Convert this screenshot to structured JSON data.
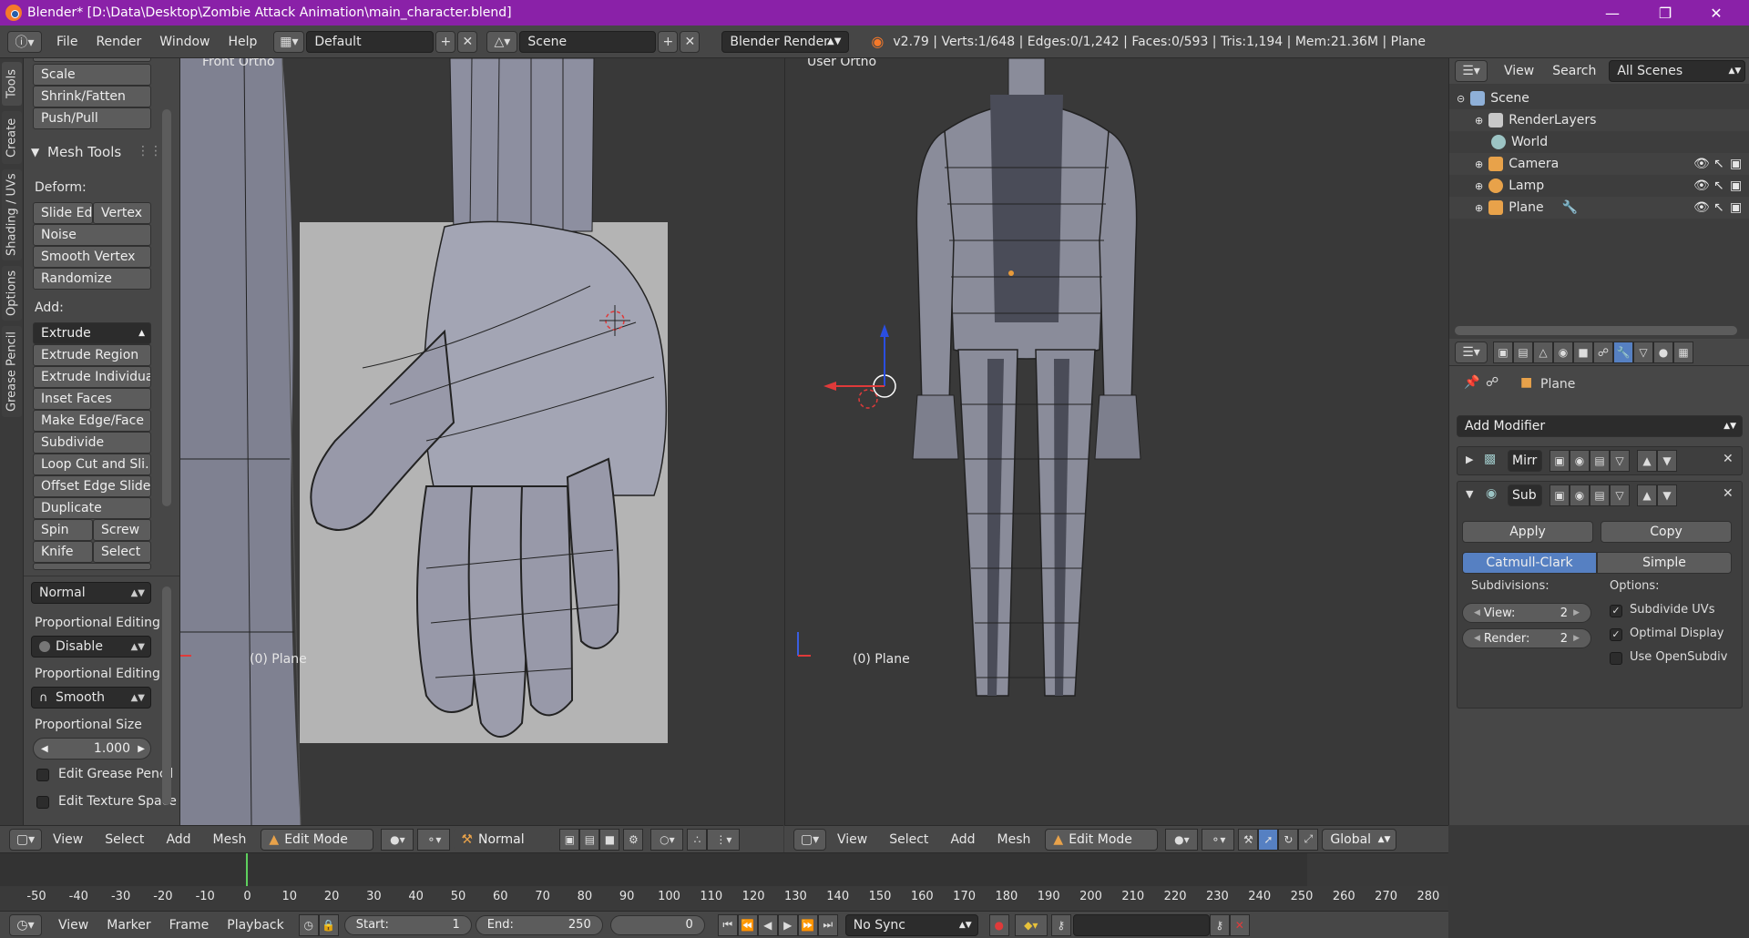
{
  "window": {
    "title": "Blender* [D:\\Data\\Desktop\\Zombie Attack Animation\\main_character.blend]"
  },
  "info_header": {
    "menus": [
      "File",
      "Render",
      "Window",
      "Help"
    ],
    "layout": "Default",
    "scene": "Scene",
    "engine": "Blender Render",
    "stats": "v2.79 | Verts:1/648 | Edges:0/1,242 | Faces:0/593 | Tris:1,194 | Mem:21.36M | Plane"
  },
  "tool_tabs": [
    "Tools",
    "Create",
    "Shading / UVs",
    "Options",
    "Grease Pencil"
  ],
  "tool_shelf": {
    "top_buttons": [
      "Scale",
      "Shrink/Fatten",
      "Push/Pull"
    ],
    "mesh_tools_title": "Mesh Tools",
    "deform_label": "Deform:",
    "deform_row": [
      "Slide Ed",
      "Vertex"
    ],
    "deform_buttons": [
      "Noise",
      "Smooth Vertex",
      "Randomize"
    ],
    "add_label": "Add:",
    "extrude": "Extrude",
    "add_buttons": [
      "Extrude Region",
      "Extrude Individual",
      "Inset Faces",
      "Make Edge/Face",
      "Subdivide",
      "Loop Cut and Sli...",
      "Offset Edge Slide",
      "Duplicate"
    ],
    "spin_row": [
      "Spin",
      "Screw"
    ],
    "knife_row": [
      "Knife",
      "Select"
    ],
    "orientation": "Normal",
    "prop_editing_label": "Proportional Editing",
    "prop_editing_value": "Disable",
    "prop_falloff_label": "Proportional Editing F",
    "prop_falloff_value": "Smooth",
    "prop_size_label": "Proportional Size",
    "prop_size_value": "1.000",
    "edit_grease_pencil": "Edit Grease Pencil",
    "edit_texture_space": "Edit Texture Space"
  },
  "viewport_left": {
    "label": "Front Ortho",
    "object": "(0) Plane",
    "menus": [
      "View",
      "Select",
      "Add",
      "Mesh"
    ],
    "mode": "Edit Mode",
    "pivot": "Normal"
  },
  "viewport_right": {
    "label": "User Ortho",
    "object": "(0) Plane",
    "menus": [
      "View",
      "Select",
      "Add",
      "Mesh"
    ],
    "mode": "Edit Mode",
    "orientation": "Global"
  },
  "outliner": {
    "menus": [
      "View",
      "Search"
    ],
    "filter": "All Scenes",
    "items": [
      {
        "name": "Scene",
        "icon_color": "#8fb0d8"
      },
      {
        "name": "RenderLayers",
        "icon_color": "#c8c8c8"
      },
      {
        "name": "World",
        "icon_color": "#9cc4c4"
      },
      {
        "name": "Camera",
        "icon_color": "#e8a24a"
      },
      {
        "name": "Lamp",
        "icon_color": "#e8a24a"
      },
      {
        "name": "Plane",
        "icon_color": "#e8a24a"
      }
    ]
  },
  "properties": {
    "object_name": "Plane",
    "add_modifier": "Add Modifier",
    "modifier1": "Mirr",
    "modifier2": "Sub",
    "apply": "Apply",
    "copy": "Copy",
    "catmull": "Catmull-Clark",
    "simple": "Simple",
    "subdivisions_label": "Subdivisions:",
    "options_label": "Options:",
    "view_label": "View:",
    "view_value": "2",
    "render_label": "Render:",
    "render_value": "2",
    "subdivide_uvs": "Subdivide UVs",
    "optimal_display": "Optimal Display",
    "use_opensubdiv": "Use OpenSubdiv"
  },
  "timeline": {
    "ticks": [
      "-50",
      "-40",
      "-30",
      "-20",
      "-10",
      "0",
      "10",
      "20",
      "30",
      "40",
      "50",
      "60",
      "70",
      "80",
      "90",
      "100",
      "110",
      "120",
      "130",
      "140",
      "150",
      "160",
      "170",
      "180",
      "190",
      "200",
      "210",
      "220",
      "230",
      "240",
      "250",
      "260",
      "270",
      "280"
    ],
    "menus": [
      "View",
      "Marker",
      "Frame",
      "Playback"
    ],
    "start_label": "Start:",
    "start_value": "1",
    "end_label": "End:",
    "end_value": "250",
    "current_frame": "0",
    "sync": "No Sync"
  },
  "colors": {
    "titlebar": "#8a21a8",
    "accent_blue": "#5680c2",
    "mesh": "#8a8c9a"
  }
}
